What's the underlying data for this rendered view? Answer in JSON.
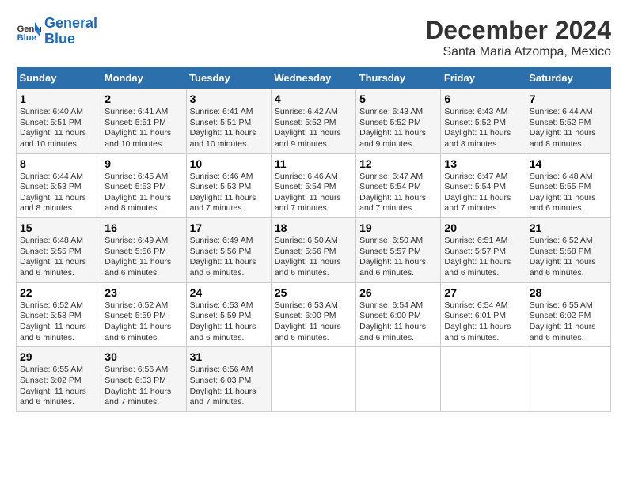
{
  "logo": {
    "line1": "General",
    "line2": "Blue"
  },
  "title": "December 2024",
  "location": "Santa Maria Atzompa, Mexico",
  "days_of_week": [
    "Sunday",
    "Monday",
    "Tuesday",
    "Wednesday",
    "Thursday",
    "Friday",
    "Saturday"
  ],
  "weeks": [
    [
      {
        "day": "1",
        "sunrise": "6:40 AM",
        "sunset": "5:51 PM",
        "daylight": "11 hours and 10 minutes."
      },
      {
        "day": "2",
        "sunrise": "6:41 AM",
        "sunset": "5:51 PM",
        "daylight": "11 hours and 10 minutes."
      },
      {
        "day": "3",
        "sunrise": "6:41 AM",
        "sunset": "5:51 PM",
        "daylight": "11 hours and 10 minutes."
      },
      {
        "day": "4",
        "sunrise": "6:42 AM",
        "sunset": "5:52 PM",
        "daylight": "11 hours and 9 minutes."
      },
      {
        "day": "5",
        "sunrise": "6:43 AM",
        "sunset": "5:52 PM",
        "daylight": "11 hours and 9 minutes."
      },
      {
        "day": "6",
        "sunrise": "6:43 AM",
        "sunset": "5:52 PM",
        "daylight": "11 hours and 8 minutes."
      },
      {
        "day": "7",
        "sunrise": "6:44 AM",
        "sunset": "5:52 PM",
        "daylight": "11 hours and 8 minutes."
      }
    ],
    [
      {
        "day": "8",
        "sunrise": "6:44 AM",
        "sunset": "5:53 PM",
        "daylight": "11 hours and 8 minutes."
      },
      {
        "day": "9",
        "sunrise": "6:45 AM",
        "sunset": "5:53 PM",
        "daylight": "11 hours and 8 minutes."
      },
      {
        "day": "10",
        "sunrise": "6:46 AM",
        "sunset": "5:53 PM",
        "daylight": "11 hours and 7 minutes."
      },
      {
        "day": "11",
        "sunrise": "6:46 AM",
        "sunset": "5:54 PM",
        "daylight": "11 hours and 7 minutes."
      },
      {
        "day": "12",
        "sunrise": "6:47 AM",
        "sunset": "5:54 PM",
        "daylight": "11 hours and 7 minutes."
      },
      {
        "day": "13",
        "sunrise": "6:47 AM",
        "sunset": "5:54 PM",
        "daylight": "11 hours and 7 minutes."
      },
      {
        "day": "14",
        "sunrise": "6:48 AM",
        "sunset": "5:55 PM",
        "daylight": "11 hours and 6 minutes."
      }
    ],
    [
      {
        "day": "15",
        "sunrise": "6:48 AM",
        "sunset": "5:55 PM",
        "daylight": "11 hours and 6 minutes."
      },
      {
        "day": "16",
        "sunrise": "6:49 AM",
        "sunset": "5:56 PM",
        "daylight": "11 hours and 6 minutes."
      },
      {
        "day": "17",
        "sunrise": "6:49 AM",
        "sunset": "5:56 PM",
        "daylight": "11 hours and 6 minutes."
      },
      {
        "day": "18",
        "sunrise": "6:50 AM",
        "sunset": "5:56 PM",
        "daylight": "11 hours and 6 minutes."
      },
      {
        "day": "19",
        "sunrise": "6:50 AM",
        "sunset": "5:57 PM",
        "daylight": "11 hours and 6 minutes."
      },
      {
        "day": "20",
        "sunrise": "6:51 AM",
        "sunset": "5:57 PM",
        "daylight": "11 hours and 6 minutes."
      },
      {
        "day": "21",
        "sunrise": "6:52 AM",
        "sunset": "5:58 PM",
        "daylight": "11 hours and 6 minutes."
      }
    ],
    [
      {
        "day": "22",
        "sunrise": "6:52 AM",
        "sunset": "5:58 PM",
        "daylight": "11 hours and 6 minutes."
      },
      {
        "day": "23",
        "sunrise": "6:52 AM",
        "sunset": "5:59 PM",
        "daylight": "11 hours and 6 minutes."
      },
      {
        "day": "24",
        "sunrise": "6:53 AM",
        "sunset": "5:59 PM",
        "daylight": "11 hours and 6 minutes."
      },
      {
        "day": "25",
        "sunrise": "6:53 AM",
        "sunset": "6:00 PM",
        "daylight": "11 hours and 6 minutes."
      },
      {
        "day": "26",
        "sunrise": "6:54 AM",
        "sunset": "6:00 PM",
        "daylight": "11 hours and 6 minutes."
      },
      {
        "day": "27",
        "sunrise": "6:54 AM",
        "sunset": "6:01 PM",
        "daylight": "11 hours and 6 minutes."
      },
      {
        "day": "28",
        "sunrise": "6:55 AM",
        "sunset": "6:02 PM",
        "daylight": "11 hours and 6 minutes."
      }
    ],
    [
      {
        "day": "29",
        "sunrise": "6:55 AM",
        "sunset": "6:02 PM",
        "daylight": "11 hours and 6 minutes."
      },
      {
        "day": "30",
        "sunrise": "6:56 AM",
        "sunset": "6:03 PM",
        "daylight": "11 hours and 7 minutes."
      },
      {
        "day": "31",
        "sunrise": "6:56 AM",
        "sunset": "6:03 PM",
        "daylight": "11 hours and 7 minutes."
      },
      null,
      null,
      null,
      null
    ]
  ]
}
